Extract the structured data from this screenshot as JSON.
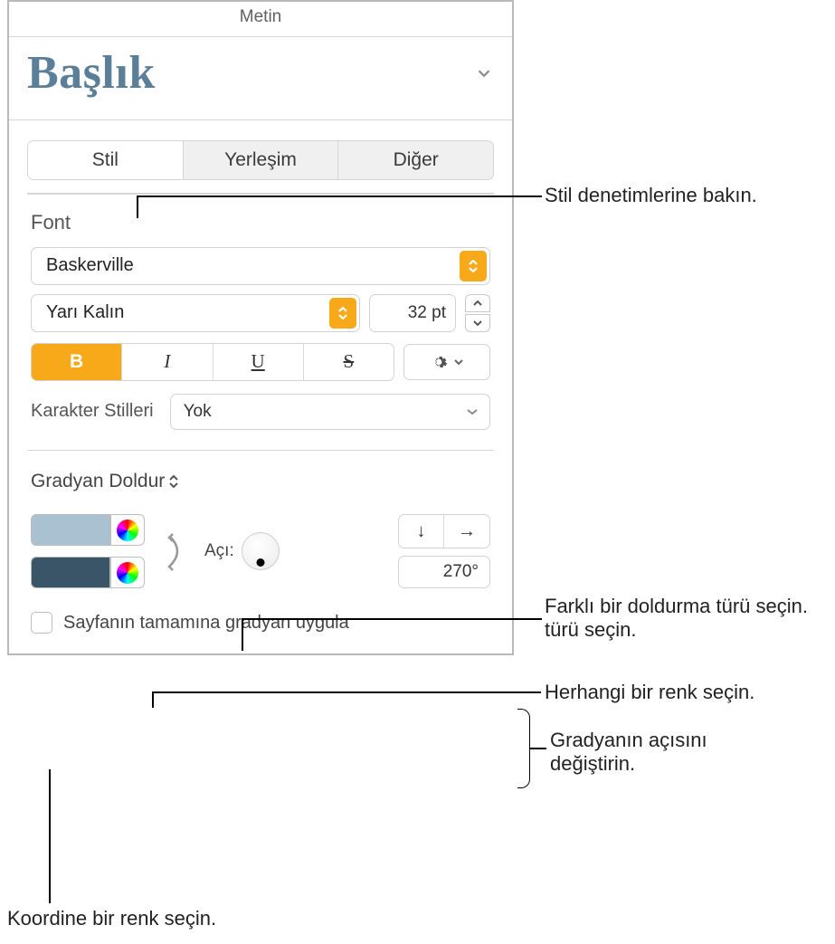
{
  "panel_title": "Metin",
  "style_preview": "Başlık",
  "tabs": [
    "Stil",
    "Yerleşim",
    "Diğer"
  ],
  "font_label": "Font",
  "font_name": "Baskerville",
  "font_weight": "Yarı Kalın",
  "font_size": "32 pt",
  "bius": {
    "bold": "B",
    "italic": "I",
    "underline": "U",
    "strike": "S"
  },
  "char_styles_label": "Karakter Stilleri",
  "char_styles_value": "Yok",
  "fill_type": "Gradyan Doldur",
  "gradient": {
    "color1": "#aac1d1",
    "color2": "#3a5567",
    "angle_label": "Açı:",
    "angle_value": "270°",
    "glyph_down": "↓",
    "glyph_right": "→"
  },
  "full_page_checkbox": "Sayfanın tamamına gradyan uygula",
  "callouts": {
    "style_controls": "Stil denetimlerine bakın.",
    "fill_type": "Farklı bir doldurma türü seçin.",
    "fill_type2": "",
    "any_color": "Herhangi bir renk seçin.",
    "gradient_angle_l1": "Gradyanın açısını",
    "gradient_angle_l2": "değiştirin.",
    "coord_color": "Koordine bir renk seçin."
  }
}
